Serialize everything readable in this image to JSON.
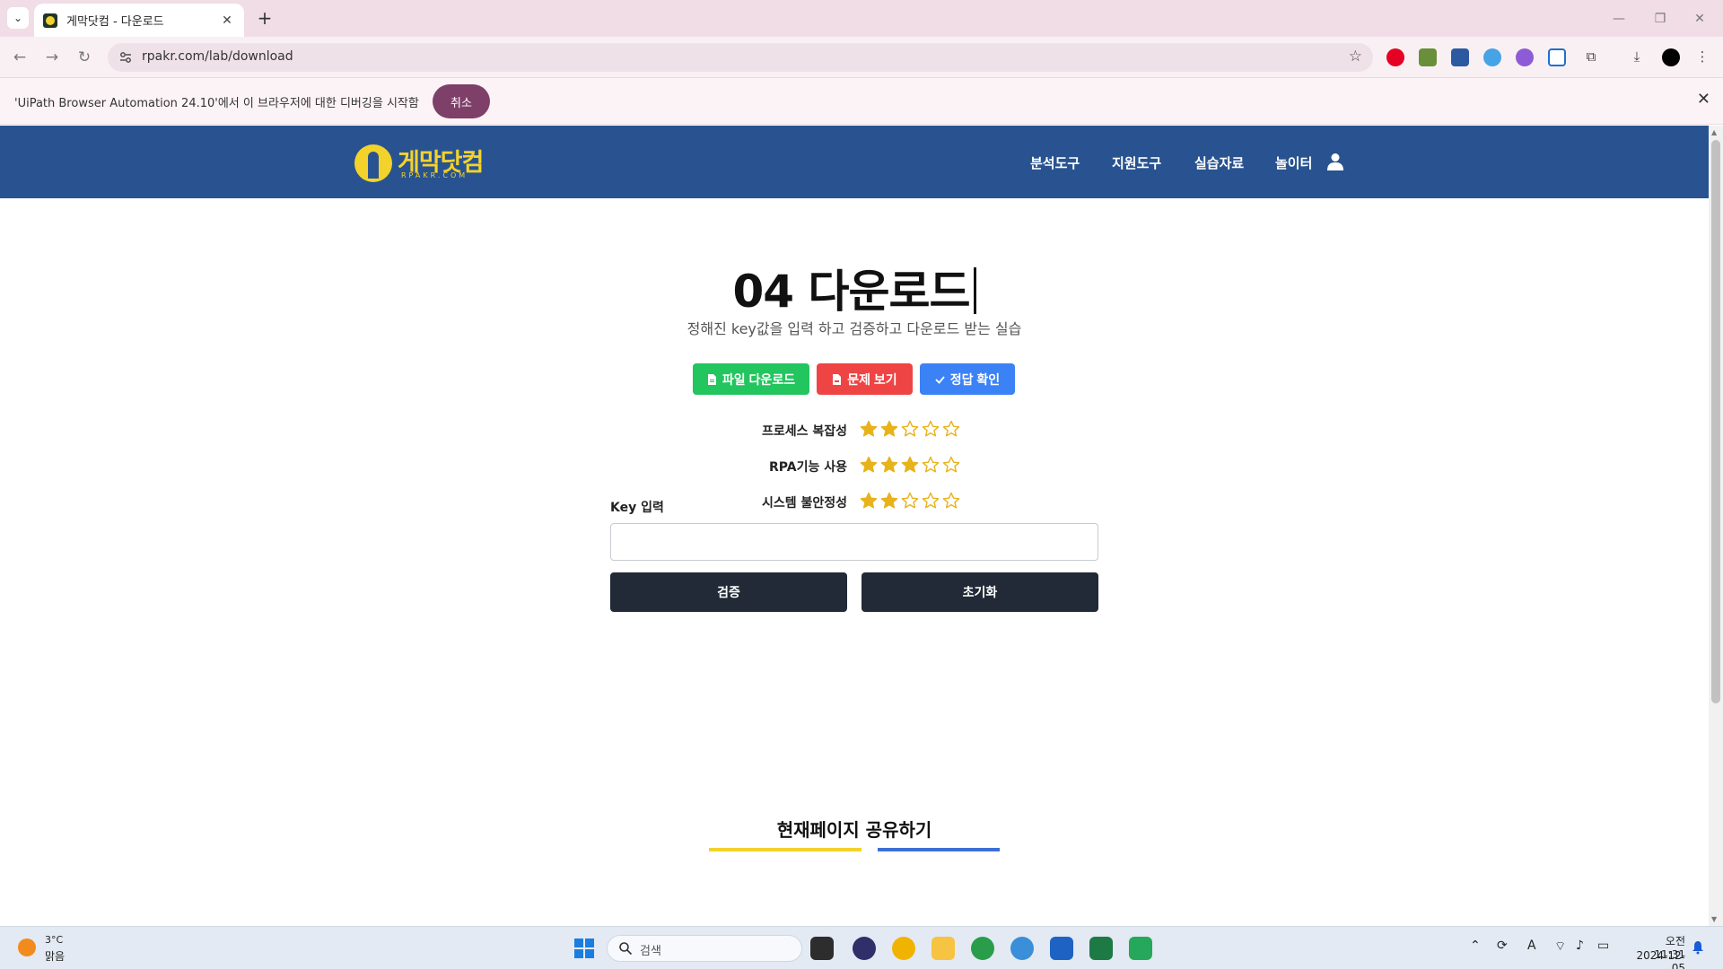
{
  "browser": {
    "tab_title": "게막닷컴 - 다운로드",
    "url": "rpakr.com/lab/download",
    "infobar_message": "'UiPath Browser Automation 24.10'에서 이 브라우저에 대한 디버깅을 시작함",
    "infobar_cancel": "취소"
  },
  "site": {
    "logo_text": "게막닷컴",
    "logo_sub": "RPAKR.COM",
    "menu": [
      "분석도구",
      "지원도구",
      "실습자료",
      "놀이터"
    ]
  },
  "page": {
    "title": "04 다운로드",
    "description": "정해진 key값을 입력 하고 검증하고 다운로드 받는 실습",
    "buttons": {
      "download": "파일 다운로드",
      "problem": "문제 보기",
      "answer": "정답 확인"
    },
    "button_colors": {
      "download": "#22c55e",
      "problem": "#ef4444",
      "answer": "#3b82f6"
    },
    "ratings": [
      {
        "label": "프로세스 복잡성",
        "value": 2,
        "max": 5
      },
      {
        "label": "RPA기능 사용",
        "value": 3,
        "max": 5
      },
      {
        "label": "시스템 불안정성",
        "value": 2,
        "max": 5
      }
    ],
    "key_label": "Key 입력",
    "key_value": "",
    "verify": "검증",
    "reset": "초기화",
    "share_title": "현재페이지 공유하기"
  },
  "taskbar": {
    "temperature": "3°C",
    "weather": "맑음",
    "search_placeholder": "검색",
    "time": "오전 11:31",
    "date": "2024-12-05"
  }
}
